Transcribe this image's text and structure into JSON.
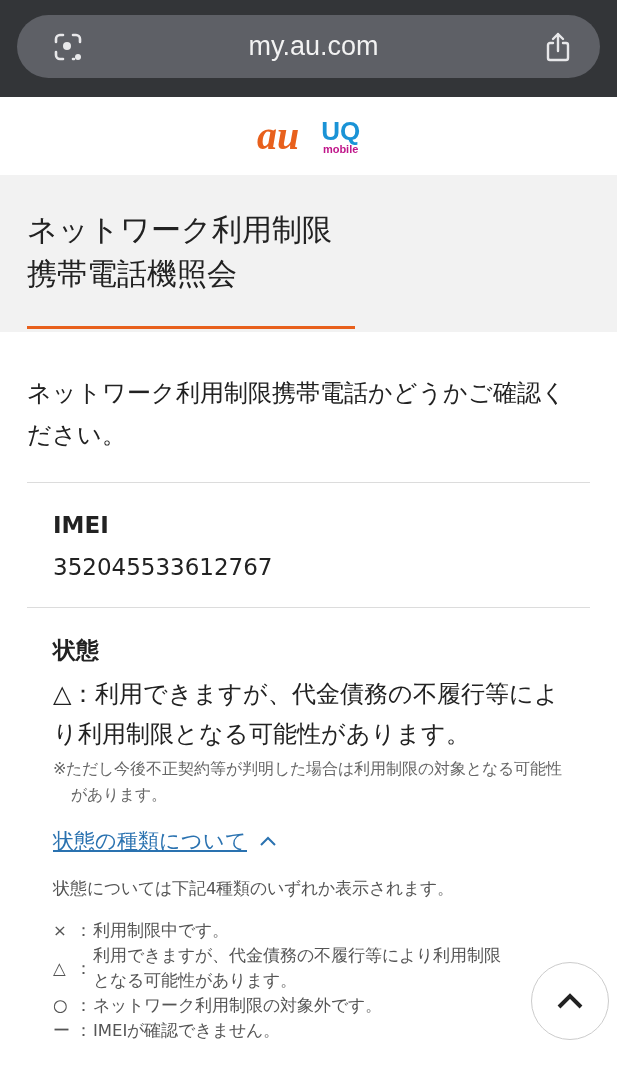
{
  "browser": {
    "url": "my.au.com"
  },
  "brand": {
    "logo_au": "au",
    "logo_uq": "UQ",
    "logo_uq_sub": "mobile"
  },
  "page_title": [
    "ネットワーク利用制限",
    "携帯電話機照会"
  ],
  "intro": "ネットワーク利用制限携帯電話かどうかご確認ください。",
  "imei": {
    "label": "IMEI",
    "value": "352045533612767"
  },
  "status": {
    "label": "状態",
    "value": "△：利用できますが、代金債務の不履行等により利用制限となる可能性があります。",
    "note": "※ただし今後不正契約等が判明した場合は利用制限の対象となる可能性があります。"
  },
  "status_types": {
    "link": "状態の種類について",
    "expanded": true,
    "intro": "状態については下記4種類のいずれか表示されます。",
    "items": [
      {
        "symbol": "×",
        "separator": "：",
        "text": "利用制限中です。"
      },
      {
        "symbol": "△",
        "separator": "：",
        "text": "利用できますが、代金債務の不履行等により利用制限となる可能性があります。"
      },
      {
        "symbol": "○",
        "separator": "：",
        "text": "ネットワーク利用制限の対象外です。"
      },
      {
        "symbol": "ー",
        "separator": "：",
        "text": "IMEIが確認できません。"
      }
    ]
  }
}
